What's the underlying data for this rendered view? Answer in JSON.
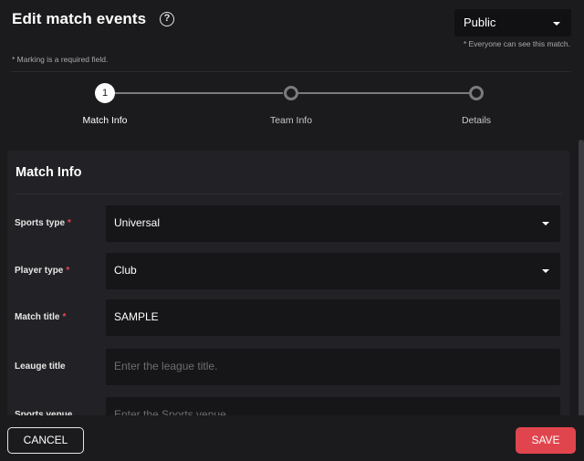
{
  "header": {
    "title": "Edit match events",
    "help_icon": "?",
    "visibility_value": "Public",
    "visibility_note": "* Everyone can see this match.",
    "required_note": "* Marking is a required field."
  },
  "stepper": {
    "steps": [
      {
        "number": "1",
        "label": "Match Info",
        "active": true
      },
      {
        "number": "",
        "label": "Team Info",
        "active": false
      },
      {
        "number": "",
        "label": "Details",
        "active": false
      }
    ]
  },
  "section": {
    "title": "Match Info",
    "fields": [
      {
        "label": "Sports type",
        "required": "*",
        "value": "Universal",
        "placeholder": "",
        "type": "select"
      },
      {
        "label": "Player type",
        "required": "*",
        "value": "Club",
        "placeholder": "",
        "type": "select"
      },
      {
        "label": "Match title",
        "required": "*",
        "value": "SAMPLE",
        "placeholder": "",
        "type": "input"
      },
      {
        "label": "Leauge title",
        "required": "",
        "value": "",
        "placeholder": "Enter the league title.",
        "type": "input"
      },
      {
        "label": "Sports venue",
        "required": "",
        "value": "",
        "placeholder": "Enter the Sports venue.",
        "type": "input"
      }
    ]
  },
  "footer": {
    "cancel_label": "CANCEL",
    "save_label": "SAVE"
  },
  "colors": {
    "background": "#1b1b1d",
    "card": "#222226",
    "accent": "#e0454e",
    "required": "#e8454f"
  }
}
